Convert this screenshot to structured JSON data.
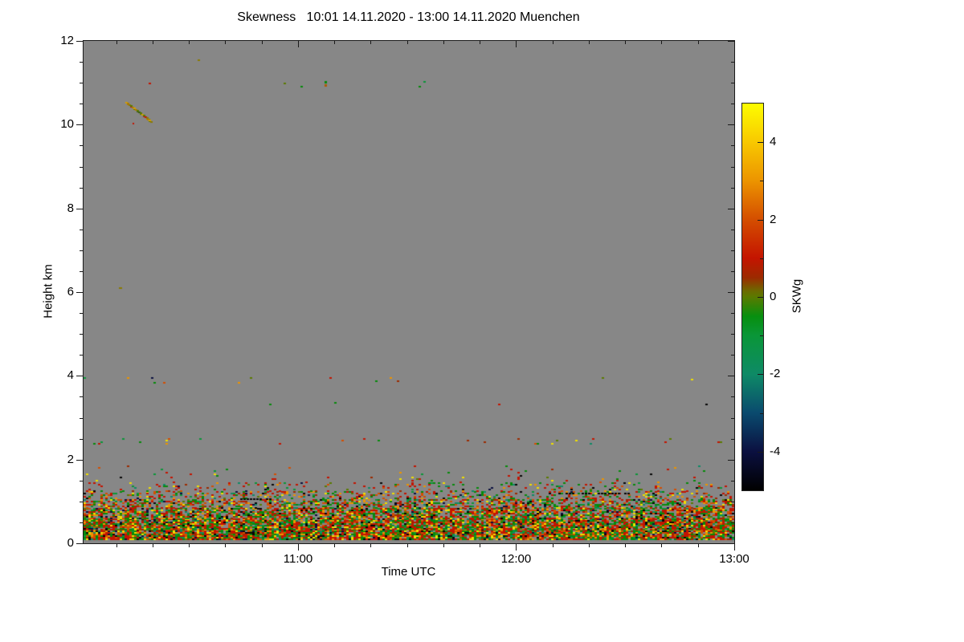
{
  "title": "Skewness   10:01 14.11.2020 - 13:00 14.11.2020 Muenchen",
  "axes": {
    "x": {
      "label": "Time UTC",
      "span_min": 179,
      "start_utc": "10:01",
      "end_utc": "13:00",
      "major_ticks": [
        {
          "offset_min": 59,
          "label": "11:00"
        },
        {
          "offset_min": 119,
          "label": "12:00"
        },
        {
          "offset_min": 179,
          "label": "13:00"
        }
      ],
      "minor_step_min": 10
    },
    "y": {
      "label": "Height km",
      "min": 0,
      "max": 12,
      "major_step": 2,
      "minor_step": 0.5,
      "tick_labels": [
        "0",
        "2",
        "4",
        "6",
        "8",
        "10",
        "12"
      ]
    }
  },
  "colorbar": {
    "label": "SKWg",
    "min": -5,
    "max": 5,
    "labeled_values": [
      4,
      2,
      0,
      -2,
      -4
    ],
    "minor_step": 1,
    "gradient_stops": [
      {
        "value": 5,
        "color": "#fdfd00"
      },
      {
        "value": 4,
        "color": "#f8c800"
      },
      {
        "value": 3,
        "color": "#ec9400"
      },
      {
        "value": 2.5,
        "color": "#e07000"
      },
      {
        "value": 2,
        "color": "#d44e00"
      },
      {
        "value": 1,
        "color": "#c41400"
      },
      {
        "value": 0.5,
        "color": "#9c2a00"
      },
      {
        "value": 0.15,
        "color": "#6b6b00"
      },
      {
        "value": 0,
        "color": "#5a7a00"
      },
      {
        "value": -0.5,
        "color": "#078f0f"
      },
      {
        "value": -1,
        "color": "#0a9638"
      },
      {
        "value": -2,
        "color": "#0e8a66"
      },
      {
        "value": -3,
        "color": "#0a4a6e"
      },
      {
        "value": -4,
        "color": "#0b1040"
      },
      {
        "value": -5,
        "color": "#000000"
      }
    ]
  },
  "chart_data": {
    "type": "heatmap",
    "title": "Skewness",
    "site": "Muenchen",
    "date": "14.11.2020",
    "time_range_utc": [
      "10:01",
      "13:00"
    ],
    "xlabel": "Time UTC",
    "ylabel": "Height km",
    "height_range_km": [
      0,
      12
    ],
    "value_label": "SKWg",
    "value_range": [
      -5,
      5
    ],
    "background_color": "#878787",
    "description": "Mostly no-data gray; dense noisy skewness speckle in boundary layer below ~1.5 km, sparse speckle lines near 2.45, 3.35 and 3.9 km, isolated specks near 6.1 and 11 km, and a short falling streak near 10.1-10.55 km around 10:12-10:19 UTC.",
    "speckle_palette": [
      {
        "color": "#c41400",
        "weight": 24
      },
      {
        "color": "#9c2a00",
        "weight": 7
      },
      {
        "color": "#d44e00",
        "weight": 11
      },
      {
        "color": "#ec9400",
        "weight": 8
      },
      {
        "color": "#f0df00",
        "weight": 7
      },
      {
        "color": "#068a0a",
        "weight": 19
      },
      {
        "color": "#0a9638",
        "weight": 7
      },
      {
        "color": "#0e8a66",
        "weight": 4
      },
      {
        "color": "#5a7a00",
        "weight": 5
      },
      {
        "color": "#060606",
        "weight": 5
      },
      {
        "color": "#0b1040",
        "weight": 3
      }
    ],
    "bands": [
      {
        "h_min": 0.08,
        "h_max": 0.35,
        "density": 0.93
      },
      {
        "h_min": 0.35,
        "h_max": 0.6,
        "density": 0.86
      },
      {
        "h_min": 0.6,
        "h_max": 0.85,
        "density": 0.72
      },
      {
        "h_min": 0.85,
        "h_max": 1.05,
        "density": 0.48
      },
      {
        "h_min": 1.05,
        "h_max": 1.25,
        "density": 0.27
      },
      {
        "h_min": 1.25,
        "h_max": 1.45,
        "density": 0.12
      },
      {
        "h_min": 1.45,
        "h_max": 1.85,
        "density": 0.022
      },
      {
        "h_min": 2.38,
        "h_max": 2.52,
        "density": 0.022
      },
      {
        "h_min": 3.28,
        "h_max": 3.38,
        "density": 0.005
      },
      {
        "h_min": 3.82,
        "h_max": 3.96,
        "density": 0.01
      },
      {
        "h_min": 10.9,
        "h_max": 11.15,
        "density": 0.0012
      }
    ],
    "dash_runs": [
      {
        "height_km": 1.07,
        "minute_from": 43,
        "minute_to": 52,
        "color": "#060606"
      },
      {
        "height_km": 1.21,
        "minute_from": 128,
        "minute_to": 150,
        "color": "#060606"
      }
    ],
    "streak": {
      "minute_from": 11.5,
      "minute_to": 18.0,
      "height_from_km": 10.55,
      "height_to_km": 10.12,
      "palette": [
        "#8a7a00",
        "#b07a00",
        "#5a7a00",
        "#c41400",
        "#3a5c10",
        "#d7a000"
      ]
    },
    "dots": [
      {
        "minute": 9.7,
        "height_km": 6.12,
        "color": "#8a7a00",
        "w": 4,
        "h": 2
      },
      {
        "minute": 55.0,
        "height_km": 11.0,
        "color": "#5a7a00",
        "w": 3,
        "h": 2
      },
      {
        "minute": 66.3,
        "height_km": 11.05,
        "color": "#068a0a",
        "w": 3,
        "h": 3
      },
      {
        "minute": 66.3,
        "height_km": 10.97,
        "color": "#b05a00",
        "w": 3,
        "h": 3
      },
      {
        "minute": 31.4,
        "height_km": 11.56,
        "color": "#8a7a00",
        "w": 3,
        "h": 2
      },
      {
        "minute": 13.5,
        "height_km": 10.05,
        "color": "#c41400",
        "w": 2,
        "h": 2
      }
    ]
  }
}
